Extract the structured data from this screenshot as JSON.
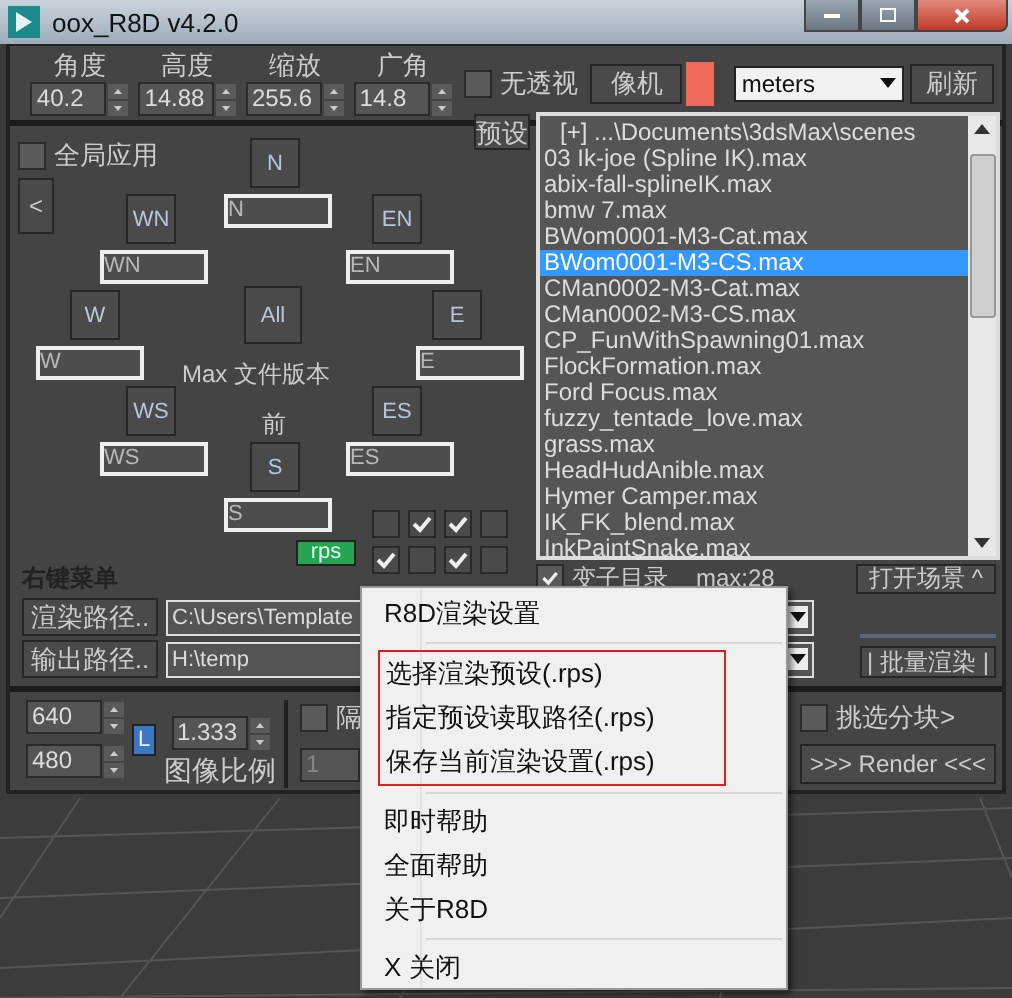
{
  "window": {
    "title": "oox_R8D v4.2.0"
  },
  "camera_fields": [
    {
      "label": "角度",
      "value": "40.2"
    },
    {
      "label": "高度",
      "value": "14.88"
    },
    {
      "label": "缩放",
      "value": "255.6"
    },
    {
      "label": "广角",
      "value": "14.8"
    }
  ],
  "no_perspective": {
    "label": "无透视",
    "checked": false
  },
  "camera_button": "像机",
  "units": {
    "value": "meters"
  },
  "refresh_button": "刷新",
  "global_apply": {
    "label": "全局应用",
    "checked": false
  },
  "back_button": "<",
  "compass": [
    {
      "kind": "N",
      "button": "N",
      "field": "N"
    },
    {
      "kind": "WN",
      "button": "WN",
      "field": "WN"
    },
    {
      "kind": "EN",
      "button": "EN",
      "field": "EN"
    },
    {
      "kind": "W",
      "button": "W",
      "field": "W"
    },
    {
      "kind": "ALL",
      "button": "All"
    },
    {
      "kind": "E",
      "button": "E",
      "field": "E"
    },
    {
      "kind": "WS",
      "button": "WS",
      "field": "WS"
    },
    {
      "kind": "ES",
      "button": "ES",
      "field": "ES"
    },
    {
      "kind": "S",
      "button": "S",
      "field": "S"
    }
  ],
  "version_label": "Max 文件版本",
  "front_label": "前",
  "rps_button": "rps",
  "toggles": [
    {
      "checked": false
    },
    {
      "checked": true
    },
    {
      "checked": true
    },
    {
      "checked": false
    },
    {
      "checked": true
    },
    {
      "checked": false
    },
    {
      "checked": true
    },
    {
      "checked": false
    }
  ],
  "preset_button": "预设",
  "file_list": [
    {
      "label": "[+] ...\\Documents\\3dsMax\\scenes",
      "selected": false
    },
    {
      "label": "03 Ik-joe (Spline IK).max",
      "selected": false
    },
    {
      "label": "abix-fall-splineIK.max",
      "selected": false
    },
    {
      "label": "bmw 7.max",
      "selected": false
    },
    {
      "label": "BWom0001-M3-Cat.max",
      "selected": false
    },
    {
      "label": "BWom0001-M3-CS.max",
      "selected": true
    },
    {
      "label": "CMan0002-M3-Cat.max",
      "selected": false
    },
    {
      "label": "CMan0002-M3-CS.max",
      "selected": false
    },
    {
      "label": "CP_FunWithSpawning01.max",
      "selected": false
    },
    {
      "label": "FlockFormation.max",
      "selected": false
    },
    {
      "label": "Ford Focus.max",
      "selected": false
    },
    {
      "label": "fuzzy_tentade_love.max",
      "selected": false
    },
    {
      "label": "grass.max",
      "selected": false
    },
    {
      "label": "HeadHudAnible.max",
      "selected": false
    },
    {
      "label": "Hymer Camper.max",
      "selected": false
    },
    {
      "label": "IK_FK_blend.max",
      "selected": false
    },
    {
      "label": "InkPaintSnake.max",
      "selected": false
    }
  ],
  "right_click_label": "右键菜单",
  "subfolders": {
    "label": "变子目录",
    "checked": true
  },
  "max_count": "max:28",
  "open_scene_button": "打开场景 ^",
  "paths": [
    {
      "button": "渲染路径..",
      "value": "C:\\Users\\Template"
    },
    {
      "button": "输出路径..",
      "value": "H:\\temp"
    }
  ],
  "batch_render_button": "| 批量渲染 |",
  "size_fields": [
    "640",
    "480"
  ],
  "lock_button": "L",
  "aspect": "1.333",
  "aspect_label": "图像比例",
  "skip_frames": {
    "label": "隔",
    "checked": false
  },
  "frame_step": "1",
  "pick_tiles": {
    "label": "挑选分块>",
    "checked": false
  },
  "render_button": ">>> Render <<<",
  "menu": [
    {
      "boxed": false,
      "items": [
        "R8D渲染设置"
      ]
    },
    {
      "boxed": true,
      "items": [
        "选择渲染预设(.rps)",
        "指定预设读取路径(.rps)",
        "保存当前渲染设置(.rps)"
      ]
    },
    {
      "boxed": false,
      "items": [
        "即时帮助",
        "全面帮助",
        "关于R8D"
      ]
    },
    {
      "boxed": false,
      "items": [
        "X 关闭"
      ]
    }
  ]
}
